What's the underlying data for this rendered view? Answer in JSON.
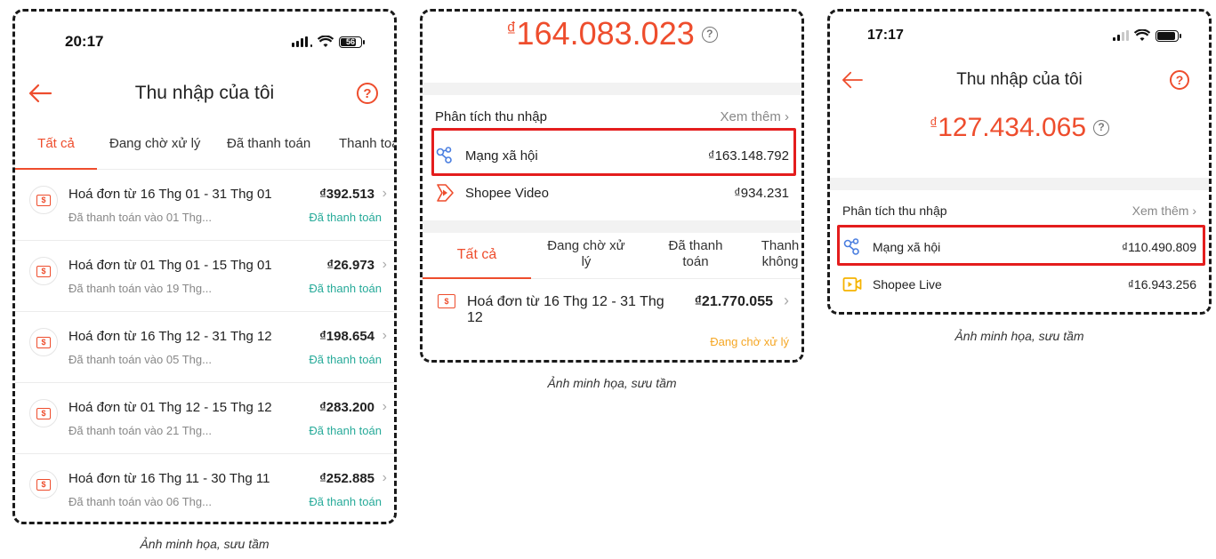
{
  "colors": {
    "accent": "#ee4d2d",
    "paid": "#26aa99",
    "pending": "#f5a623",
    "highlight": "#e41d1d"
  },
  "caption": "Ảnh minh họa, sưu tầm",
  "panel1": {
    "status_time": "20:17",
    "battery_level": "56",
    "title": "Thu nhập của tôi",
    "help": "?",
    "tabs": [
      "Tất cả",
      "Đang chờ xử lý",
      "Đã thanh toán",
      "Thanh toán"
    ],
    "invoices": [
      {
        "title": "Hoá đơn từ 16 Thg 01 - 31 Thg 01",
        "amount": "₫392.513",
        "sub": "Đã thanh toán vào 01 Thg...",
        "status": "Đã thanh toán"
      },
      {
        "title": "Hoá đơn từ 01 Thg 01 - 15 Thg 01",
        "amount": "₫26.973",
        "sub": "Đã thanh toán vào 19 Thg...",
        "status": "Đã thanh toán"
      },
      {
        "title": "Hoá đơn từ 16 Thg 12 - 31 Thg 12",
        "amount": "₫198.654",
        "sub": "Đã thanh toán vào 05 Thg...",
        "status": "Đã thanh toán"
      },
      {
        "title": "Hoá đơn từ 01 Thg 12 - 15 Thg 12",
        "amount": "₫283.200",
        "sub": "Đã thanh toán vào 21 Thg...",
        "status": "Đã thanh toán"
      },
      {
        "title": "Hoá đơn từ 16 Thg 11 - 30 Thg 11",
        "amount": "₫252.885",
        "sub": "Đã thanh toán vào 06 Thg...",
        "status": "Đã thanh toán"
      }
    ]
  },
  "panel2": {
    "currency": "₫",
    "total": "164.083.023",
    "help": "?",
    "section_title": "Phân tích thu nhập",
    "see_more": "Xem thêm",
    "sources": [
      {
        "name": "Mạng xã hội",
        "value": "₫163.148.792",
        "icon": "social-network-icon"
      },
      {
        "name": "Shopee Video",
        "value": "₫934.231",
        "icon": "shopee-video-icon"
      }
    ],
    "tabs": [
      "Tất cả",
      "Đang chờ xử lý",
      "Đã thanh toán",
      "Thanh không"
    ],
    "invoice": {
      "title": "Hoá đơn từ 16 Thg 12 - 31 Thg 12",
      "amount": "₫21.770.055",
      "status": "Đang chờ xử lý"
    }
  },
  "panel3": {
    "status_time": "17:17",
    "title": "Thu nhập của tôi",
    "help": "?",
    "currency": "₫",
    "total": "127.434.065",
    "section_title": "Phân tích thu nhập",
    "see_more": "Xem thêm",
    "sources": [
      {
        "name": "Mạng xã hội",
        "value": "₫110.490.809",
        "icon": "social-network-icon"
      },
      {
        "name": "Shopee Live",
        "value": "₫16.943.256",
        "icon": "shopee-live-icon"
      }
    ]
  }
}
